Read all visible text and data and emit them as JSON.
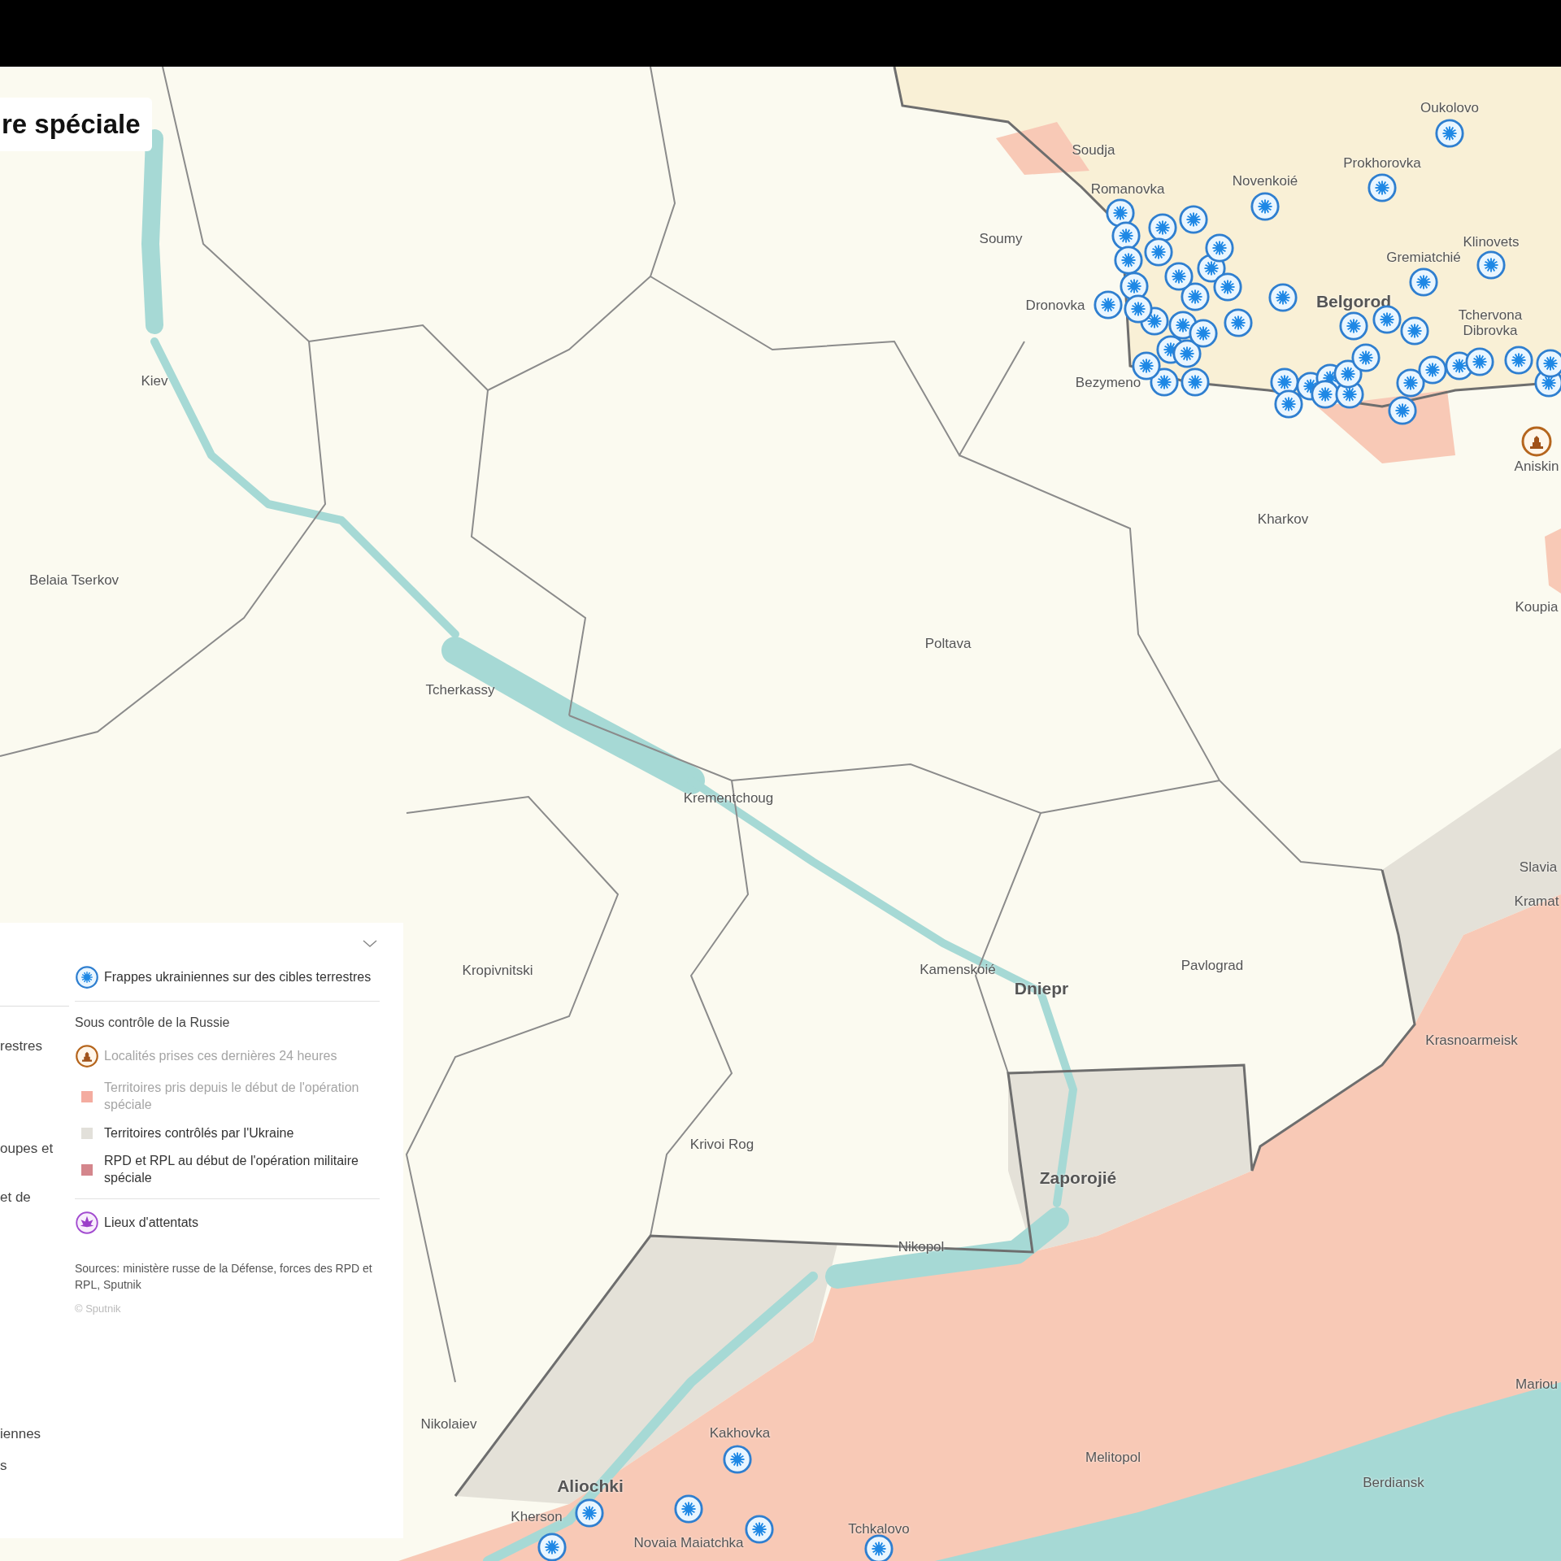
{
  "title": "re spéciale",
  "map_labels": [
    {
      "text": "Soudja",
      "major": false
    },
    {
      "text": "Romanovka",
      "major": false
    },
    {
      "text": "Novenkoié",
      "major": false
    },
    {
      "text": "Prokhorovka",
      "major": false
    },
    {
      "text": "Oukolovo",
      "major": false
    },
    {
      "text": "Soumy",
      "major": false
    },
    {
      "text": "Klinovets",
      "major": false
    },
    {
      "text": "Gremiatchié",
      "major": false
    },
    {
      "text": "Dronovka",
      "major": false
    },
    {
      "text": "Belgorod",
      "major": true
    },
    {
      "text": "Tchervona Dibrovka",
      "major": false
    },
    {
      "text": "Bezymeno",
      "major": false
    },
    {
      "text": "Aniskin",
      "major": false
    },
    {
      "text": "Kiev",
      "major": false
    },
    {
      "text": "Kharkov",
      "major": false
    },
    {
      "text": "Belaia Tserkov",
      "major": false
    },
    {
      "text": "Koupia",
      "major": false
    },
    {
      "text": "Poltava",
      "major": false
    },
    {
      "text": "Tcherkassy",
      "major": false
    },
    {
      "text": "Krementchoug",
      "major": false
    },
    {
      "text": "Slavia",
      "major": false
    },
    {
      "text": "Kramat",
      "major": false
    },
    {
      "text": "Kropivnitski",
      "major": false
    },
    {
      "text": "Kamenskoié",
      "major": false
    },
    {
      "text": "Dniepr",
      "major": true
    },
    {
      "text": "Pavlograd",
      "major": false
    },
    {
      "text": "Krasnoarmeisk",
      "major": false
    },
    {
      "text": "Krivoi Rog",
      "major": false
    },
    {
      "text": "Zaporojié",
      "major": true
    },
    {
      "text": "Nikopol",
      "major": false
    },
    {
      "text": "Mariou",
      "major": false
    },
    {
      "text": "Nikolaiev",
      "major": false
    },
    {
      "text": "Kakhovka",
      "major": false
    },
    {
      "text": "Melitopol",
      "major": false
    },
    {
      "text": "Berdiansk",
      "major": false
    },
    {
      "text": "Aliochki",
      "major": true
    },
    {
      "text": "Kherson",
      "major": false
    },
    {
      "text": "Novaia Maiatchka",
      "major": false
    },
    {
      "text": "Tchkalovo",
      "major": false
    }
  ],
  "legend": {
    "partial_texts": [
      "restres",
      "oupes et",
      "et de",
      "iennes",
      "s"
    ],
    "sections": [
      {
        "items": [
          {
            "kind": "strike",
            "label": "Frappes ukrainiennes sur des cibles terrestres",
            "disabled": false
          }
        ]
      },
      {
        "heading": "Sous contrôle de la Russie",
        "items": [
          {
            "kind": "captured",
            "label": "Localités prises ces dernières 24 heures",
            "disabled": true
          },
          {
            "kind": "swatch",
            "color": "#f4aca0",
            "label": "Territoires pris depuis le début de l'opération spéciale",
            "disabled": true
          },
          {
            "kind": "swatch",
            "color": "#e2e0da",
            "label": "Territoires contrôlés par l'Ukraine",
            "disabled": false
          },
          {
            "kind": "swatch",
            "color": "#d4868c",
            "label": "RPD et RPL au début de l'opération militaire spéciale",
            "disabled": false
          }
        ]
      },
      {
        "items": [
          {
            "kind": "attack",
            "label": "Lieux d'attentats",
            "disabled": false
          }
        ]
      }
    ],
    "sources": "Sources: ministère russe de la Défense, forces des RPD et RPL, Sputnik",
    "copyright": "© Sputnik"
  }
}
